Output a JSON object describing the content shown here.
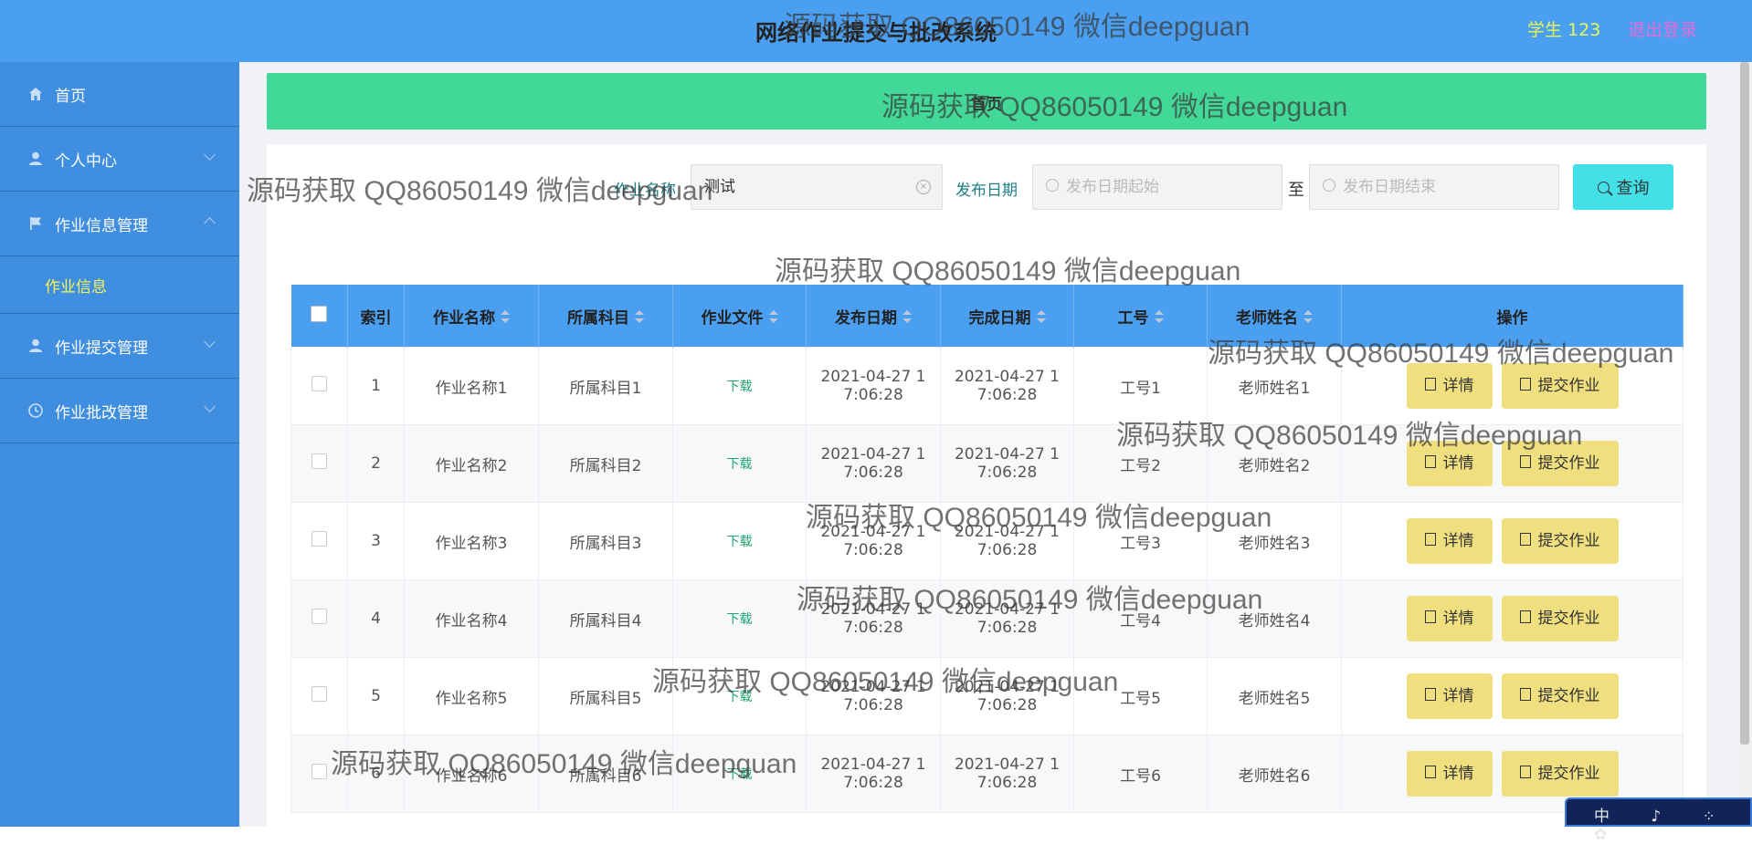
{
  "header": {
    "title": "网络作业提交与批改系统",
    "user_label": "学生 123",
    "logout_label": "退出登录"
  },
  "sidebar": {
    "items": [
      {
        "label": "首页",
        "icon": "home-icon"
      },
      {
        "label": "个人中心",
        "icon": "user-icon"
      },
      {
        "label": "作业信息管理",
        "icon": "flag-icon",
        "expanded": true
      },
      {
        "label": "作业信息",
        "submenu": true
      },
      {
        "label": "作业提交管理",
        "icon": "user-icon"
      },
      {
        "label": "作业批改管理",
        "icon": "clock-icon"
      }
    ]
  },
  "breadcrumb": {
    "label": "首页"
  },
  "search": {
    "name_label": "作业名称",
    "name_value": "测试",
    "date_label": "发布日期",
    "start_placeholder": "发布日期起始",
    "to_label": "至",
    "end_placeholder": "发布日期结束",
    "button_label": "查询"
  },
  "table": {
    "headers": [
      "索引",
      "作业名称",
      "所属科目",
      "作业文件",
      "发布日期",
      "完成日期",
      "工号",
      "老师姓名",
      "操作"
    ],
    "rows": [
      {
        "index": "1",
        "name": "作业名称1",
        "subject": "所属科目1",
        "file": "下载",
        "publish_a": "2021-04-27 1",
        "publish_b": "7:06:28",
        "finish_a": "2021-04-27 1",
        "finish_b": "7:06:28",
        "job_no": "工号1",
        "teacher": "老师姓名1"
      },
      {
        "index": "2",
        "name": "作业名称2",
        "subject": "所属科目2",
        "file": "下载",
        "publish_a": "2021-04-27 1",
        "publish_b": "7:06:28",
        "finish_a": "2021-04-27 1",
        "finish_b": "7:06:28",
        "job_no": "工号2",
        "teacher": "老师姓名2"
      },
      {
        "index": "3",
        "name": "作业名称3",
        "subject": "所属科目3",
        "file": "下载",
        "publish_a": "2021-04-27 1",
        "publish_b": "7:06:28",
        "finish_a": "2021-04-27 1",
        "finish_b": "7:06:28",
        "job_no": "工号3",
        "teacher": "老师姓名3"
      },
      {
        "index": "4",
        "name": "作业名称4",
        "subject": "所属科目4",
        "file": "下载",
        "publish_a": "2021-04-27 1",
        "publish_b": "7:06:28",
        "finish_a": "2021-04-27 1",
        "finish_b": "7:06:28",
        "job_no": "工号4",
        "teacher": "老师姓名4"
      },
      {
        "index": "5",
        "name": "作业名称5",
        "subject": "所属科目5",
        "file": "下载",
        "publish_a": "2021-04-27 1",
        "publish_b": "7:06:28",
        "finish_a": "2021-04-27 1",
        "finish_b": "7:06:28",
        "job_no": "工号5",
        "teacher": "老师姓名5"
      },
      {
        "index": "6",
        "name": "作业名称6",
        "subject": "所属科目6",
        "file": "下载",
        "publish_a": "2021-04-27 1",
        "publish_b": "7:06:28",
        "finish_a": "2021-04-27 1",
        "finish_b": "7:06:28",
        "job_no": "工号6",
        "teacher": "老师姓名6"
      }
    ],
    "detail_label": "详情",
    "submit_label": "提交作业"
  },
  "watermark": "源码获取 QQ86050149 微信deepguan",
  "ime_widget": "中 ♪ ⁘ ✿",
  "colors": {
    "header_bg": "#4a9ff0",
    "sidebar_bg": "#3f8ee0",
    "breadcrumb_bg": "#42d898",
    "search_button": "#43e0e8",
    "action_button": "#f0df7f",
    "download_link": "#1fa56e",
    "user_label": "#e8f85a",
    "logout": "#e86ad6",
    "submenu_active": "#f4f45c"
  }
}
